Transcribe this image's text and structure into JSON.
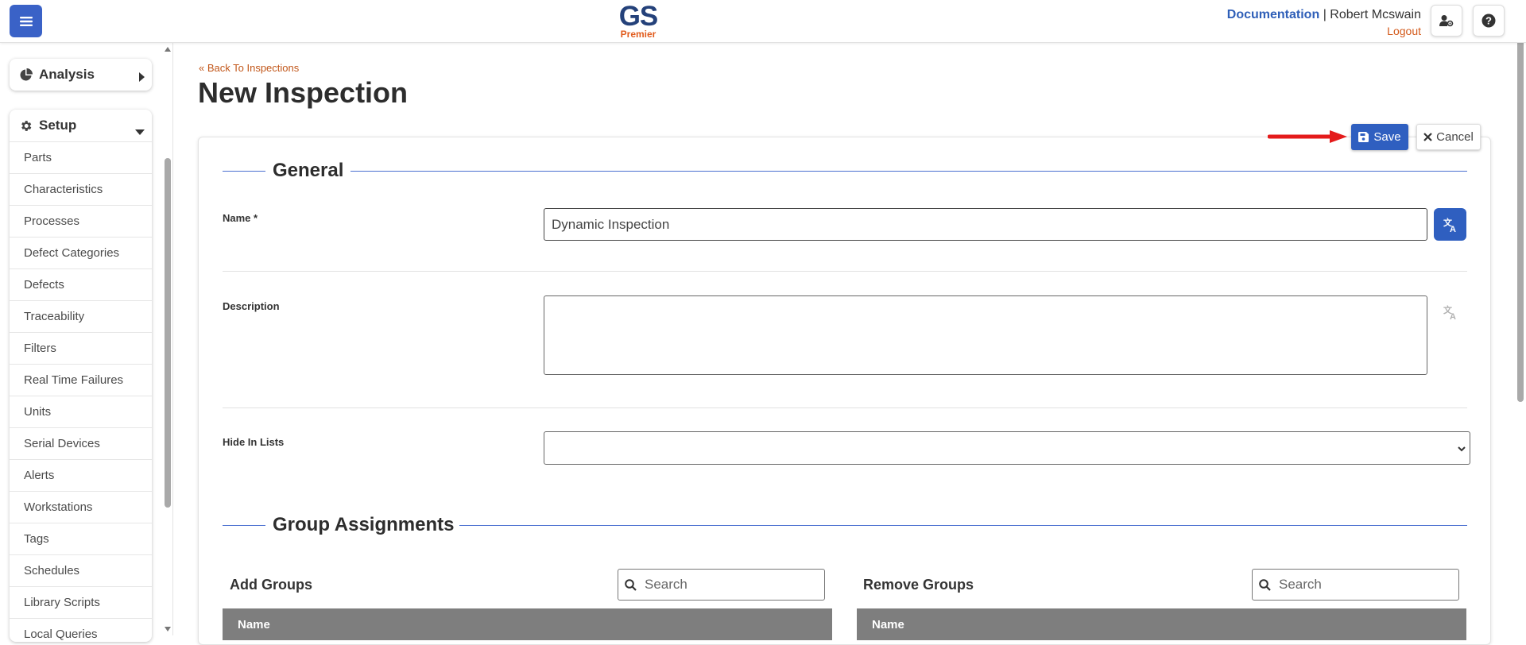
{
  "header": {
    "logo_main": "GS",
    "logo_sub": "Premier",
    "documentation_link": "Documentation",
    "separator": "|",
    "user_name": "Robert Mcswain",
    "logout_link": "Logout"
  },
  "sidebar": {
    "analysis_label": "Analysis",
    "setup_label": "Setup",
    "items": [
      {
        "label": "Parts"
      },
      {
        "label": "Characteristics"
      },
      {
        "label": "Processes"
      },
      {
        "label": "Defect Categories"
      },
      {
        "label": "Defects"
      },
      {
        "label": "Traceability"
      },
      {
        "label": "Filters"
      },
      {
        "label": "Real Time Failures"
      },
      {
        "label": "Units"
      },
      {
        "label": "Serial Devices"
      },
      {
        "label": "Alerts"
      },
      {
        "label": "Workstations"
      },
      {
        "label": "Tags"
      },
      {
        "label": "Schedules"
      },
      {
        "label": "Library Scripts"
      },
      {
        "label": "Local Queries"
      }
    ]
  },
  "main": {
    "back_link": "Back To Inspections",
    "page_title": "New Inspection",
    "save_label": "Save",
    "cancel_label": "Cancel",
    "general_section": "General",
    "name_label": "Name *",
    "name_value": "Dynamic Inspection",
    "description_label": "Description",
    "description_value": "",
    "hide_in_lists_label": "Hide In Lists",
    "hide_in_lists_value": "",
    "group_section": "Group Assignments",
    "add_groups_label": "Add Groups",
    "remove_groups_label": "Remove Groups",
    "search_placeholder": "Search",
    "name_column": "Name"
  },
  "colors": {
    "primary": "#2f5fc0",
    "accent_orange": "#d35a1b",
    "logo_blue": "#24417a",
    "table_header": "#7e7e7e",
    "annotation_arrow": "#e41b1b"
  },
  "icons": {
    "menu": "hamburger-icon",
    "user_settings": "user-cog-icon",
    "help": "question-circle-icon",
    "analysis": "pie-chart-icon",
    "setup": "gear-icon",
    "save": "floppy-disk-icon",
    "cancel": "x-icon",
    "translate": "translate-icon",
    "search": "search-icon",
    "back": "double-chevron-left-icon"
  }
}
